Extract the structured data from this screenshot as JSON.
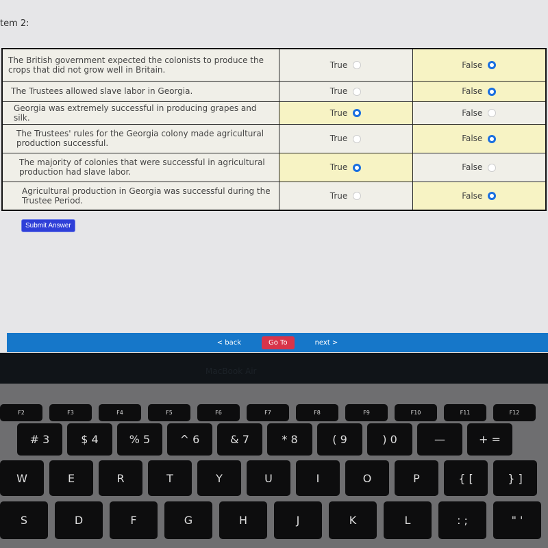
{
  "item_label": "tem 2:",
  "rows": [
    {
      "statement": "The British government expected the colonists to produce the crops that did not grow well in Britain.",
      "answer": "False"
    },
    {
      "statement": "The Trustees allowed slave labor in Georgia.",
      "answer": "False"
    },
    {
      "statement": "Georgia was extremely successful in producing grapes and silk.",
      "answer": "True"
    },
    {
      "statement": "The Trustees' rules for the Georgia colony made agricultural production successful.",
      "answer": "False"
    },
    {
      "statement": "The majority of colonies that were successful in agricultural production had slave labor.",
      "answer": "True"
    },
    {
      "statement": "Agricultural production in Georgia was successful during the Trustee Period.",
      "answer": "False"
    }
  ],
  "true_label": "True",
  "false_label": "False",
  "submit_label": "Submit Answer",
  "nav": {
    "back": "< back",
    "goto": "Go To",
    "next": "next >"
  },
  "laptop_brand": "MacBook Air",
  "colors": {
    "selected_bg": "#f7f3c4",
    "radio": "#1a6fe0",
    "navbar": "#1677c9",
    "goto": "#d8344a",
    "submit": "#2f3fd8"
  },
  "keyboard": {
    "fn_row": [
      "F2",
      "F3",
      "F4",
      "F5",
      "F6",
      "F7",
      "F8",
      "F9",
      "F10",
      "F11",
      "F12"
    ],
    "num_row": [
      "# 3",
      "$ 4",
      "% 5",
      "^ 6",
      "& 7",
      "* 8",
      "( 9",
      ") 0",
      "—",
      "+ ="
    ],
    "top_row": [
      "W",
      "E",
      "R",
      "T",
      "Y",
      "U",
      "I",
      "O",
      "P",
      "{ [",
      "} ]"
    ],
    "mid_row": [
      "S",
      "D",
      "F",
      "G",
      "H",
      "J",
      "K",
      "L",
      ": ;",
      "\" '"
    ]
  }
}
